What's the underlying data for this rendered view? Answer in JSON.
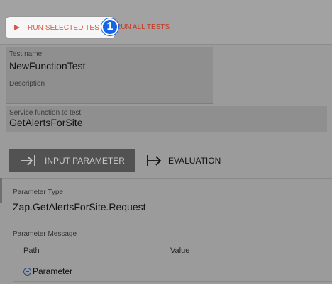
{
  "toolbar": {
    "run_selected_label": "RUN SELECTED TEST",
    "run_all_label": "RUN ALL TESTS",
    "step_badge": "1",
    "accent_color": "#d65a47",
    "badge_color": "#1565e6"
  },
  "form": {
    "test_name": {
      "label": "Test name",
      "value": "NewFunctionTest"
    },
    "description": {
      "label": "Description",
      "value": ""
    },
    "service_function": {
      "label": "Service function to test",
      "value": "GetAlertsForSite"
    }
  },
  "tabs": {
    "input_parameter": {
      "label": "INPUT PARAMETER",
      "icon": "arrow-into-bar-icon",
      "active": true
    },
    "evaluation": {
      "label": "EVALUATION",
      "icon": "arrow-from-bar-icon",
      "active": false
    }
  },
  "parameter": {
    "type_label": "Parameter Type",
    "type_value": "Zap.GetAlertsForSite.Request",
    "message_label": "Parameter Message",
    "table": {
      "columns": [
        "Path",
        "Value"
      ],
      "rows": [
        {
          "path": "Parameter",
          "value": "",
          "expanded": true
        }
      ]
    }
  }
}
